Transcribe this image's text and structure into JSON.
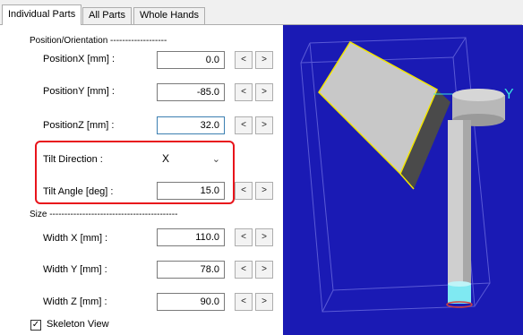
{
  "tabs": [
    {
      "label": "Individual Parts",
      "active": true
    },
    {
      "label": "All Parts",
      "active": false
    },
    {
      "label": "Whole Hands",
      "active": false
    }
  ],
  "position_section": {
    "header": "Position/Orientation -------------------",
    "rows": [
      {
        "label": "PositionX [mm] :",
        "value": "0.0"
      },
      {
        "label": "PositionY [mm] :",
        "value": "-85.0"
      },
      {
        "label": "PositionZ [mm] :",
        "value": "32.0"
      }
    ]
  },
  "tilt": {
    "direction_label": "Tilt Direction :",
    "direction_value": "X",
    "angle_label": "Tilt Angle [deg] :",
    "angle_value": "15.0"
  },
  "size_section": {
    "header": "Size -------------------------------------------",
    "rows": [
      {
        "label": "Width X [mm] :",
        "value": "110.0"
      },
      {
        "label": "Width Y [mm] :",
        "value": "78.0"
      },
      {
        "label": "Width Z [mm] :",
        "value": "90.0"
      }
    ]
  },
  "step_buttons": {
    "decrement": "<",
    "increment": ">"
  },
  "skeleton_view": {
    "label": "Skeleton View",
    "checked": true,
    "mark": "✓"
  },
  "viewport": {
    "axis_label": "Y"
  },
  "colors": {
    "viewport_bg": "#1a1ab4",
    "highlight": "#e8141b",
    "cube_face": "#c8c8c8",
    "cube_edge": "#f2e600",
    "cylinder": "#bdbdbd",
    "cyan_segment": "#7fe9f2"
  },
  "icons": {
    "chevron": "chevron-down-icon",
    "check": "check-icon"
  }
}
